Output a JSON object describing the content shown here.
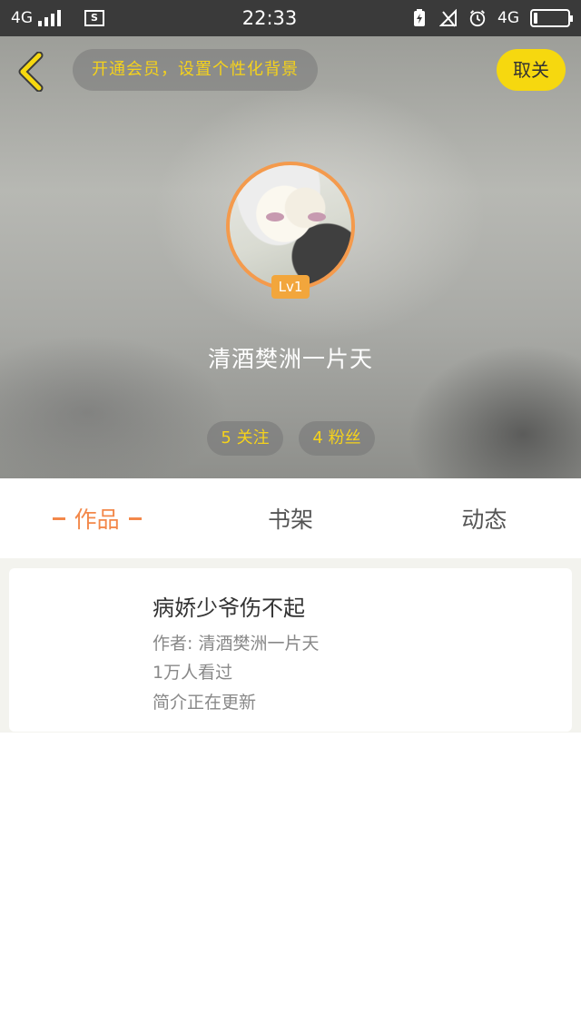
{
  "status_bar": {
    "network": "4G",
    "time": "22:33",
    "network_right": "4G",
    "battery_level": 0.1
  },
  "header": {
    "back_icon": "chevron-left-icon",
    "vip_prompt": "开通会员，设置个性化背景",
    "unfollow_label": "取关",
    "level": "Lv1",
    "username": "清酒樊洲一片天",
    "following": "5 关注",
    "fans": "4 粉丝",
    "colors": {
      "accent_yellow": "#f5d21b",
      "avatar_ring": "#f49a4c"
    }
  },
  "tabs": [
    {
      "label": "作品",
      "active": true
    },
    {
      "label": "书架",
      "active": false
    },
    {
      "label": "动态",
      "active": false
    }
  ],
  "works": [
    {
      "title": "病娇少爷伤不起",
      "author": "作者: 清酒樊洲一片天",
      "views": "1万人看过",
      "description": "简介正在更新"
    }
  ]
}
